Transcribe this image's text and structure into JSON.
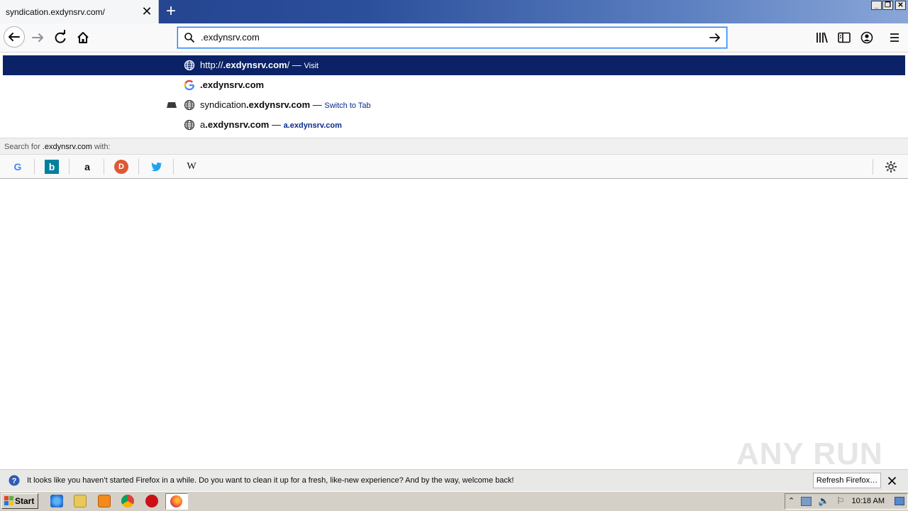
{
  "tab": {
    "title": "syndication.exdynsrv.com/"
  },
  "window_buttons": [
    "_",
    "❐",
    "✕"
  ],
  "urlbar": {
    "value": ".exdynsrv.com"
  },
  "dropdown": {
    "rows": [
      {
        "prefix": "http://",
        "bold": ".exdynsrv.com",
        "suffix": "/",
        "sep": " — ",
        "action": "Visit"
      },
      {
        "prefix": "",
        "bold": ".exdynsrv.com",
        "suffix": "",
        "sep": "",
        "action": ""
      },
      {
        "prefix": "syndication",
        "bold": ".exdynsrv.com",
        "suffix": "",
        "sep": " — ",
        "action": "Switch to Tab"
      },
      {
        "prefix": "a",
        "bold": ".exdynsrv.com",
        "suffix": "",
        "sep": " — ",
        "action": "a.exdynsrv.com"
      }
    ],
    "search_with": {
      "prefix": "Search for ",
      "query": ".exdynsrv.com",
      "suffix": " with:"
    },
    "engines": [
      "Google",
      "Bing",
      "Amazon",
      "DuckDuckGo",
      "Twitter",
      "Wikipedia"
    ]
  },
  "notification": {
    "text": "It looks like you haven’t started Firefox in a while. Do you want to clean it up for a fresh, like-new experience? And by the way, welcome back!",
    "button": "Refresh Firefox…"
  },
  "taskbar": {
    "start_label": "Start",
    "clock": "10:18 AM"
  },
  "watermark": "ANY RUN",
  "colors": {
    "selected_row": "#0b2266",
    "tab_strip": "#2c4f9c",
    "action_text": "#0a2a8a"
  }
}
